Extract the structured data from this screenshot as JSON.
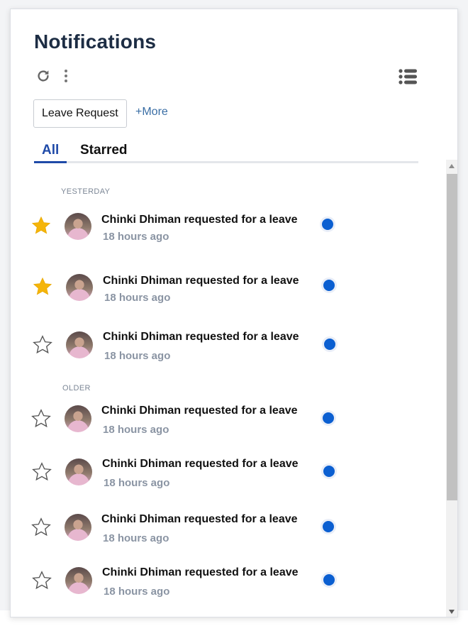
{
  "panel": {
    "title": "Notifications",
    "icons": {
      "refresh": "refresh-icon",
      "more": "more-vertical-icon",
      "list": "list-view-icon"
    },
    "filter_chip": "Leave Request",
    "more_link": "+More"
  },
  "tabs": [
    {
      "label": "All",
      "active": true
    },
    {
      "label": "Starred",
      "active": false
    }
  ],
  "sections": {
    "yesterday": "YESTERDAY",
    "older": "OLDER"
  },
  "notifications": [
    {
      "message": "Chinki Dhiman requested for a leave",
      "time": "18 hours ago",
      "starred": true,
      "unread": true
    },
    {
      "message": "Chinki Dhiman requested for a leave",
      "time": "18 hours ago",
      "starred": true,
      "unread": true
    },
    {
      "message": "Chinki Dhiman requested for a leave",
      "time": "18 hours ago",
      "starred": false,
      "unread": true
    },
    {
      "message": "Chinki Dhiman requested for a leave",
      "time": "18 hours ago",
      "starred": false,
      "unread": true
    },
    {
      "message": "Chinki Dhiman requested for a leave",
      "time": "18 hours ago",
      "starred": false,
      "unread": true
    },
    {
      "message": "Chinki Dhiman requested for a leave",
      "time": "18 hours ago",
      "starred": false,
      "unread": true
    },
    {
      "message": "Chinki Dhiman requested for a leave",
      "time": "18 hours ago",
      "starred": false,
      "unread": true
    }
  ],
  "colors": {
    "title": "#1d2d44",
    "accent": "#1f4aa8",
    "star_filled": "#f5b50a",
    "unread_dot": "#0b5fd1",
    "muted": "#8a94a3"
  }
}
